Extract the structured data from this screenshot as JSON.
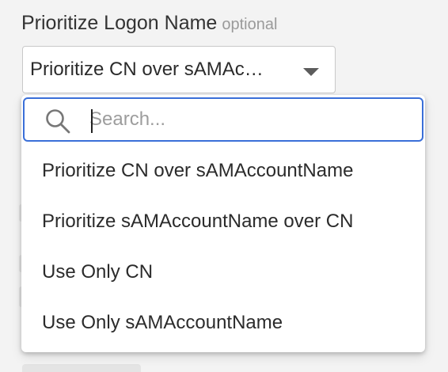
{
  "field": {
    "label": "Prioritize Logon Name",
    "optional_text": "optional",
    "selected_value": "Prioritize CN over sAMAc…"
  },
  "dropdown": {
    "search": {
      "placeholder": "Search...",
      "value": "",
      "icon": "search-icon"
    },
    "options": [
      {
        "label": "Prioritize CN over sAMAccountName"
      },
      {
        "label": "Prioritize sAMAccountName over CN"
      },
      {
        "label": "Use Only CN"
      },
      {
        "label": "Use Only sAMAccountName"
      }
    ]
  },
  "colors": {
    "focus_border": "#3a6fd8",
    "background": "#f3f3f3",
    "text": "#2b2b2b",
    "muted": "#9a9a9a"
  }
}
